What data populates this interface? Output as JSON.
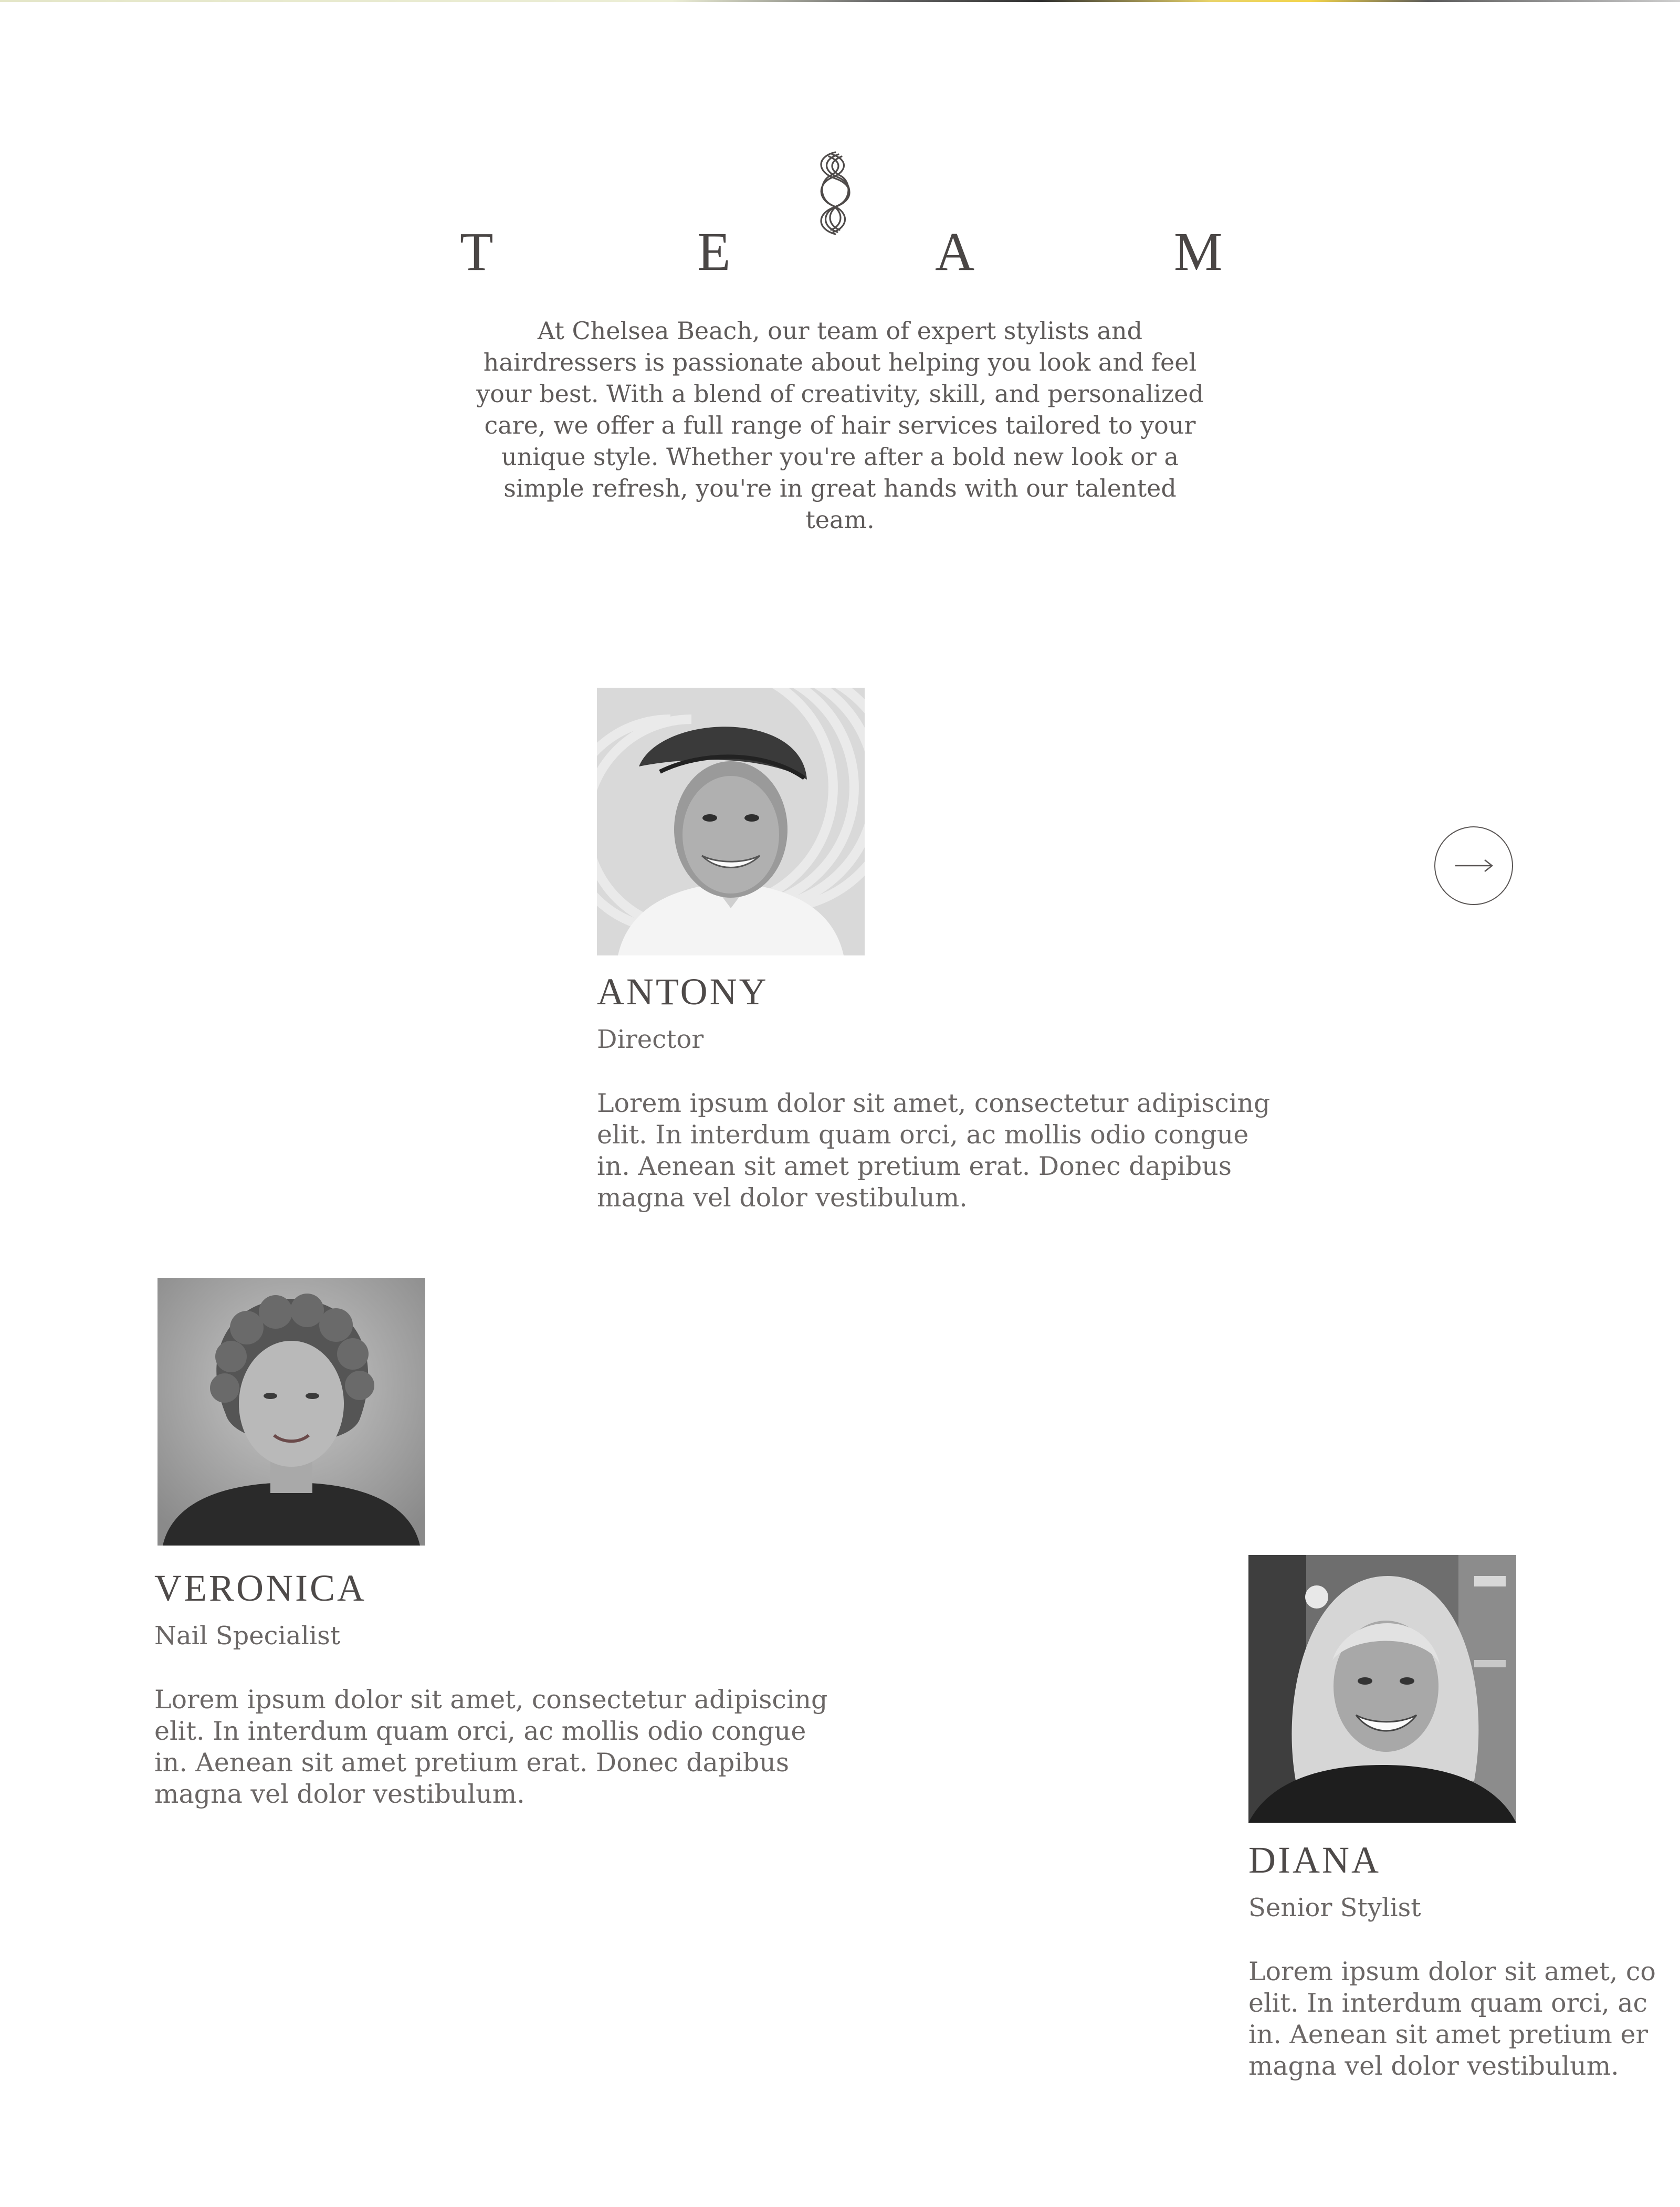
{
  "page": {
    "title_letters": [
      "T",
      "E",
      "A",
      "M"
    ],
    "intro": "At Chelsea Beach, our team of expert stylists and hairdressers is passionate about helping you look and feel your best. With a blend of creativity, skill, and personalized care, we offer a full range of hair services tailored to your unique style. Whether you're after a bold new look or a simple refresh, you're in great hands with our talented team."
  },
  "team": [
    {
      "name": "ANTONY",
      "role": "Director",
      "bio": "Lorem ipsum dolor sit amet, consectetur adipiscing\nelit. In interdum quam orci, ac mollis odio congue\nin. Aenean sit amet pretium erat. Donec dapibus\nmagna vel dolor vestibulum."
    },
    {
      "name": "VERONICA",
      "role": "Nail Specialist",
      "bio": "Lorem ipsum dolor sit amet, consectetur adipiscing\nelit. In interdum quam orci, ac mollis odio congue\nin. Aenean sit amet pretium erat. Donec dapibus\nmagna vel dolor vestibulum."
    },
    {
      "name": "DIANA",
      "role": "Senior Stylist",
      "bio": "Lorem ipsum dolor sit amet, co\nelit. In interdum quam orci, ac\nin. Aenean sit amet pretium er\nmagna vel dolor vestibulum."
    }
  ],
  "icons": {
    "logo": "wave-logo-icon",
    "next": "arrow-right-icon"
  },
  "colors": {
    "text": "#5a5655",
    "heading": "#4a4645",
    "background": "#ffffff"
  }
}
